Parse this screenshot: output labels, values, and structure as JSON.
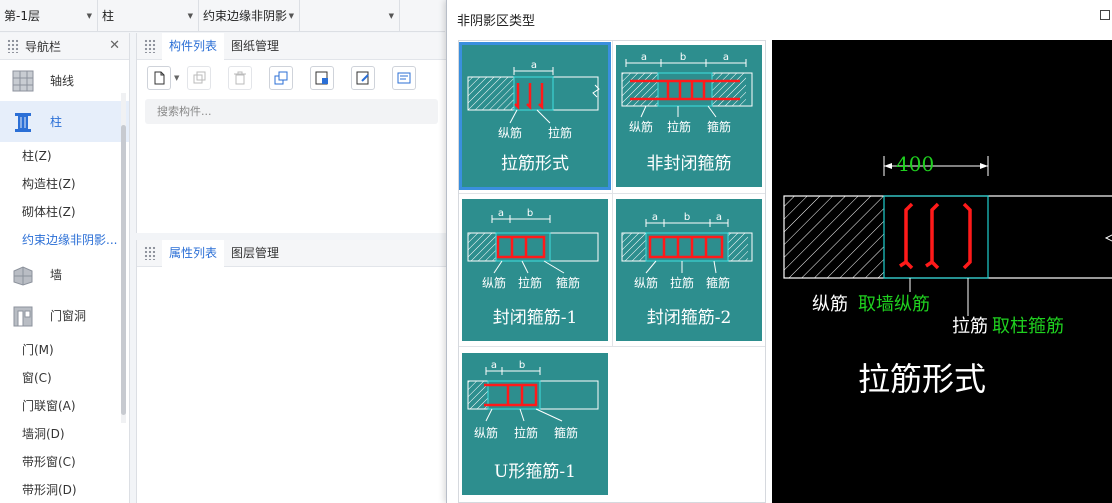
{
  "topbar": {
    "floor": "第-1层",
    "type": "柱",
    "subtype": "约束边缘非阴影"
  },
  "nav": {
    "title": "导航栏",
    "categories": [
      {
        "label": "轴线",
        "icon": "grid-axis-icon"
      },
      {
        "label": "柱",
        "icon": "column-icon"
      }
    ],
    "column_items": [
      "柱(Z)",
      "构造柱(Z)",
      "砌体柱(Z)",
      "约束边缘非阴影..."
    ],
    "wall_label": "墙",
    "door_window_label": "门窗洞",
    "door_items": [
      "门(M)",
      "窗(C)",
      "门联窗(A)",
      "墙洞(D)",
      "带形窗(C)",
      "带形洞(D)"
    ]
  },
  "component_panel": {
    "tabs": [
      "构件列表",
      "图纸管理"
    ],
    "search_placeholder": "搜索构件..."
  },
  "attribute_panel": {
    "tabs": [
      "属性列表",
      "图层管理"
    ]
  },
  "dialog": {
    "title": "非阴影区类型",
    "options": [
      {
        "label": "拉筋形式",
        "selected": true,
        "dims": [
          "a"
        ],
        "notes": [
          "纵筋",
          "拉筋"
        ]
      },
      {
        "label": "非封闭箍筋",
        "selected": false,
        "dims": [
          "a",
          "b",
          "a"
        ],
        "notes": [
          "纵筋",
          "拉筋",
          "箍筋"
        ]
      },
      {
        "label": "封闭箍筋-1",
        "selected": false,
        "dims": [
          "a",
          "b"
        ],
        "notes": [
          "纵筋",
          "拉筋",
          "箍筋"
        ]
      },
      {
        "label": "封闭箍筋-2",
        "selected": false,
        "dims": [
          "a",
          "b",
          "a"
        ],
        "notes": [
          "纵筋",
          "拉筋",
          "箍筋"
        ]
      },
      {
        "label": "U形箍筋-1",
        "selected": false,
        "dims": [
          "a",
          "b"
        ],
        "notes": [
          "纵筋",
          "拉筋",
          "箍筋"
        ]
      }
    ],
    "preview": {
      "dimension": "400",
      "label_longitudinal": "纵筋",
      "label_longitudinal_source": "取墙纵筋",
      "label_tie": "拉筋",
      "label_tie_source": "取柱箍筋",
      "title": "拉筋形式"
    },
    "colors": {
      "teal": "#2d8e8e",
      "select": "#3a8fde",
      "rebar": "#ff1a1a",
      "green": "#1fd01f"
    }
  }
}
